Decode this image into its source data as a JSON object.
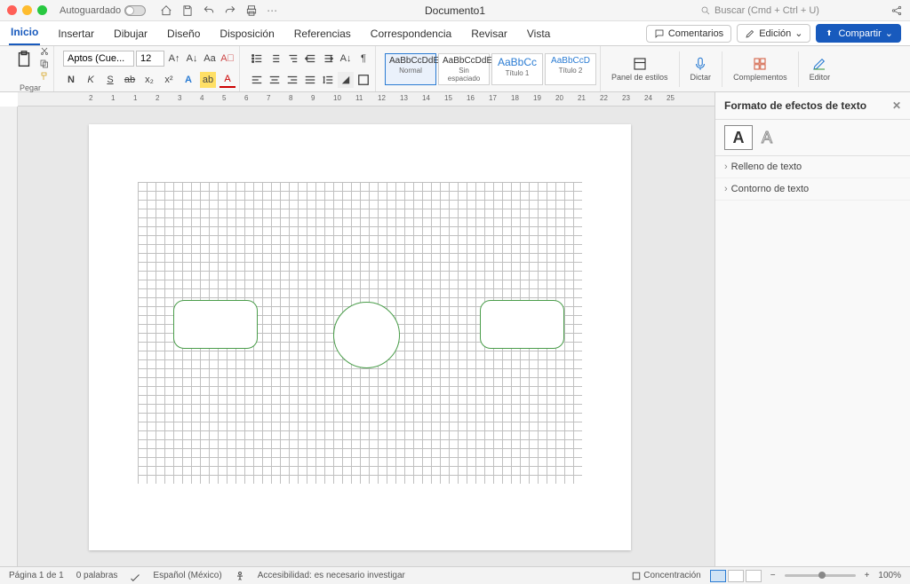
{
  "titlebar": {
    "autosave": "Autoguardado",
    "doc_title": "Documento1",
    "search_placeholder": "Buscar (Cmd + Ctrl + U)"
  },
  "tabs": {
    "items": [
      "Inicio",
      "Insertar",
      "Dibujar",
      "Diseño",
      "Disposición",
      "Referencias",
      "Correspondencia",
      "Revisar",
      "Vista"
    ],
    "comments": "Comentarios",
    "editing": "Edición",
    "share": "Compartir"
  },
  "ribbon": {
    "paste": "Pegar",
    "font_name": "Aptos (Cue...",
    "font_size": "12",
    "styles": [
      {
        "preview": "AaBbCcDdE",
        "name": "Normal"
      },
      {
        "preview": "AaBbCcDdE",
        "name": "Sin espaciado"
      },
      {
        "preview": "AaBbCc",
        "name": "Título 1"
      },
      {
        "preview": "AaBbCcD",
        "name": "Título 2"
      }
    ],
    "styles_pane": "Panel de estilos",
    "dictate": "Dictar",
    "addins": "Complementos",
    "editor": "Editor"
  },
  "sidepanel": {
    "title": "Formato de efectos de texto",
    "items": [
      "Relleno de texto",
      "Contorno de texto"
    ]
  },
  "statusbar": {
    "page": "Página 1 de 1",
    "words": "0 palabras",
    "lang": "Español (México)",
    "a11y": "Accesibilidad: es necesario investigar",
    "focus": "Concentración",
    "zoom": "100%"
  },
  "ruler_marks": [
    "2",
    "1",
    "1",
    "2",
    "3",
    "4",
    "5",
    "6",
    "7",
    "8",
    "9",
    "10",
    "11",
    "12",
    "13",
    "14",
    "15",
    "16",
    "17",
    "18",
    "19",
    "20",
    "21",
    "22",
    "23",
    "24",
    "25"
  ]
}
